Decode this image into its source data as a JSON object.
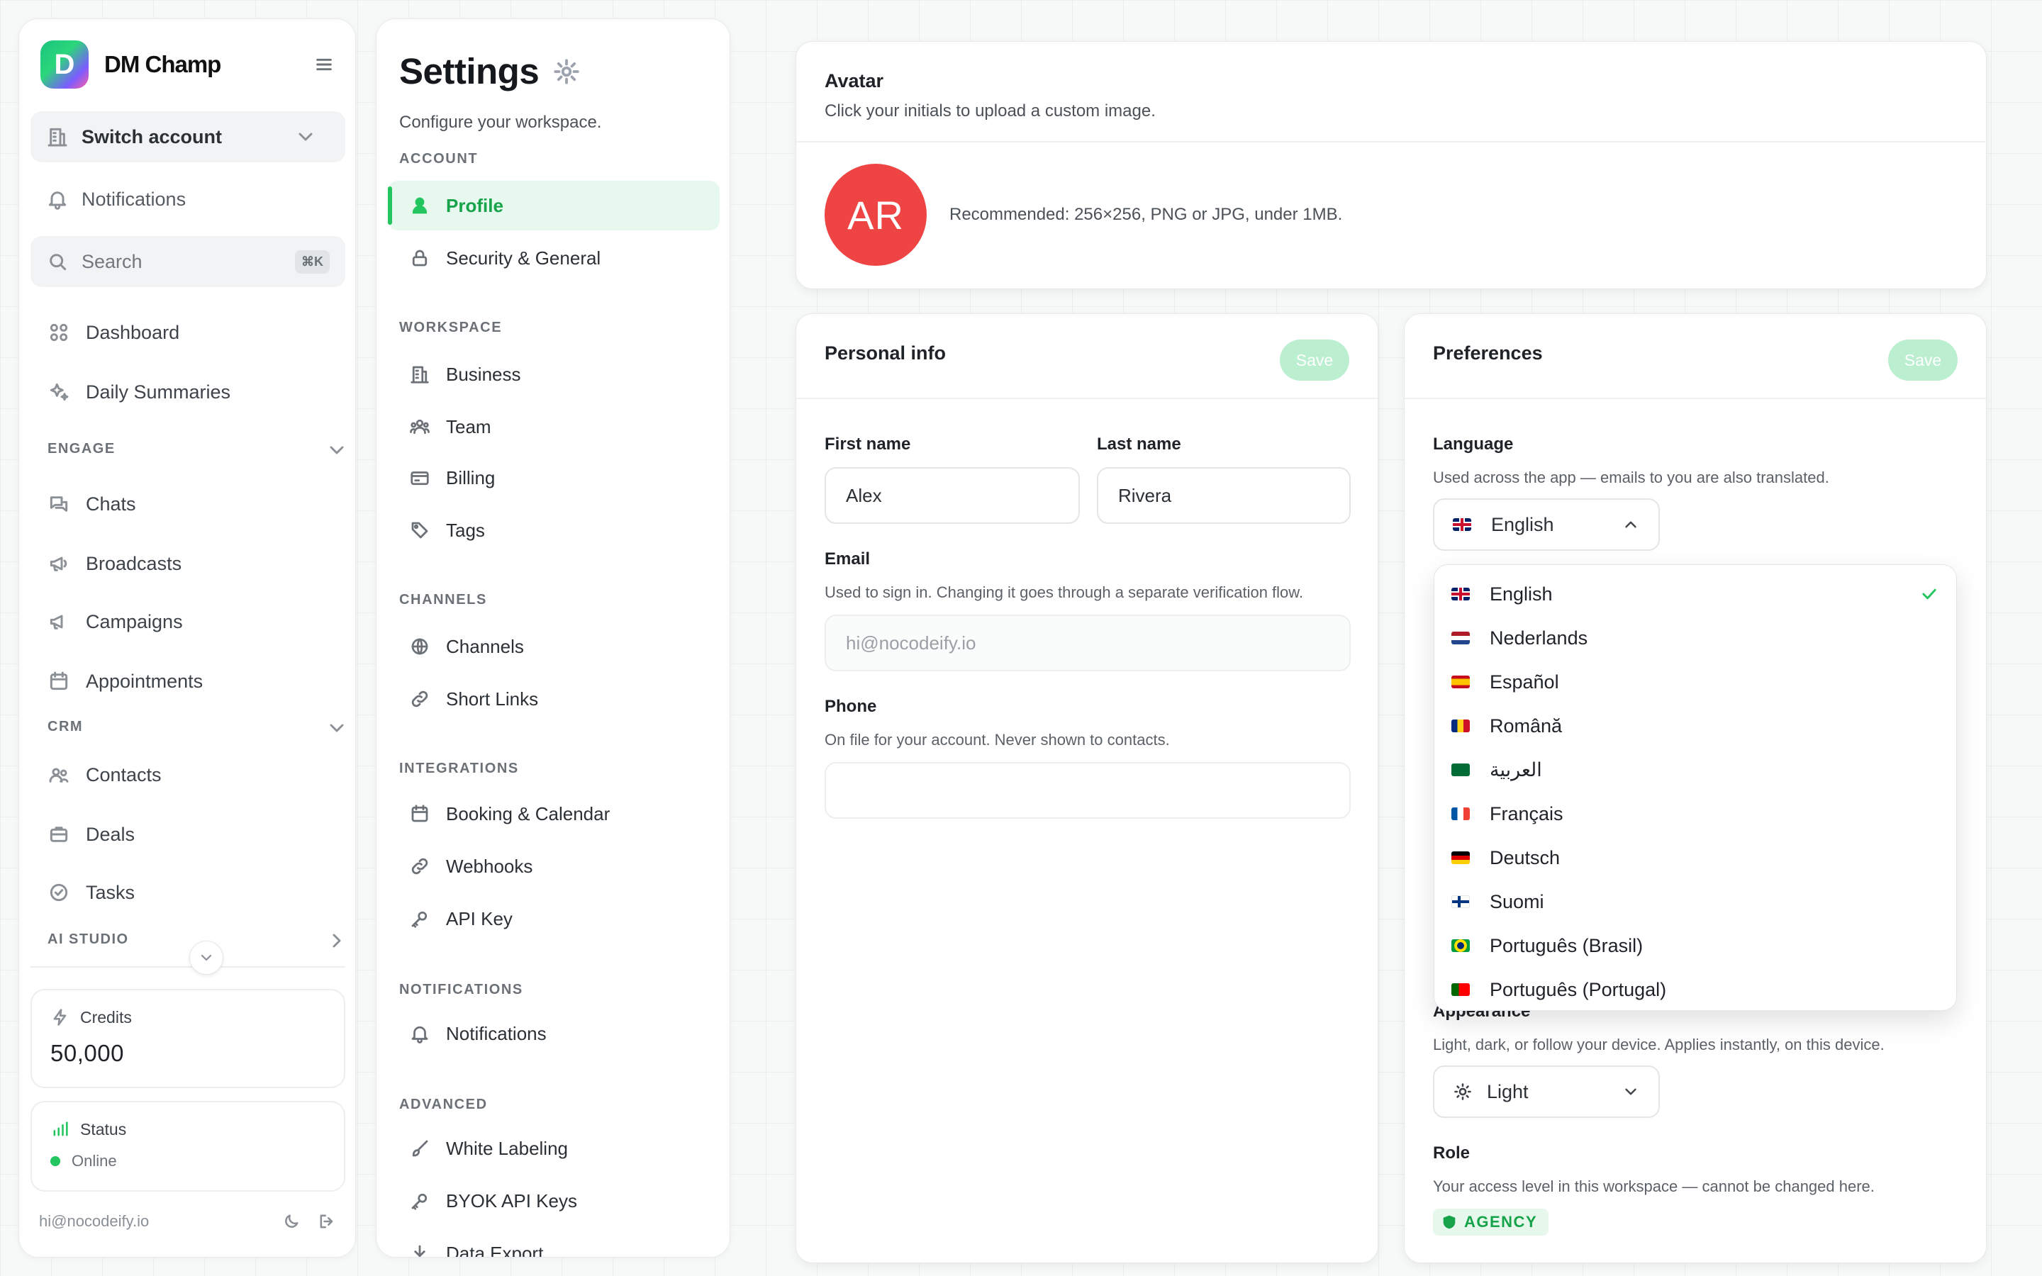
{
  "brand": {
    "logo_letter": "D",
    "name": "DM Champ"
  },
  "sidebar": {
    "switch_account": "Switch account",
    "notifications": "Notifications",
    "search_label": "Search",
    "search_shortcut": "⌘K",
    "dashboard": "Dashboard",
    "daily_summaries": "Daily Summaries",
    "engage_header": "ENGAGE",
    "chats": "Chats",
    "broadcasts": "Broadcasts",
    "campaigns": "Campaigns",
    "appointments": "Appointments",
    "crm_header": "CRM",
    "contacts": "Contacts",
    "deals": "Deals",
    "tasks": "Tasks",
    "ai_studio_header": "AI STUDIO",
    "credits_label": "Credits",
    "credits_value": "50,000",
    "status_label": "Status",
    "status_value": "Online",
    "user_email": "hi@nocodeify.io"
  },
  "settings": {
    "title": "Settings",
    "subtitle": "Configure your workspace.",
    "groups": {
      "account": "ACCOUNT",
      "workspace": "WORKSPACE",
      "channels": "CHANNELS",
      "integrations": "INTEGRATIONS",
      "notifications": "NOTIFICATIONS",
      "advanced": "ADVANCED"
    },
    "items": {
      "profile": "Profile",
      "security": "Security & General",
      "business": "Business",
      "team": "Team",
      "billing": "Billing",
      "tags": "Tags",
      "channels": "Channels",
      "short_links": "Short Links",
      "booking": "Booking & Calendar",
      "webhooks": "Webhooks",
      "api_key": "API Key",
      "notifications": "Notifications",
      "white_labeling": "White Labeling",
      "byok": "BYOK API Keys",
      "data_export": "Data Export"
    }
  },
  "avatar": {
    "title": "Avatar",
    "subtitle": "Click your initials to upload a custom image.",
    "initials": "AR",
    "recommendation": "Recommended: 256×256, PNG or JPG, under 1MB."
  },
  "personal": {
    "title": "Personal info",
    "save": "Save",
    "first_name_label": "First name",
    "first_name": "Alex",
    "last_name_label": "Last name",
    "last_name": "Rivera",
    "email_label": "Email",
    "email_help": "Used to sign in. Changing it goes through a separate verification flow.",
    "email": "hi@nocodeify.io",
    "phone_label": "Phone",
    "phone_help": "On file for your account. Never shown to contacts.",
    "phone": ""
  },
  "preferences": {
    "title": "Preferences",
    "save": "Save",
    "language_label": "Language",
    "language_help": "Used across the app — emails to you are also translated.",
    "language_selected": "English",
    "language_options": [
      "English",
      "Nederlands",
      "Español",
      "Română",
      "العربية",
      "Français",
      "Deutsch",
      "Suomi",
      "Português (Brasil)",
      "Português (Portugal)"
    ],
    "appearance_label": "Appearance",
    "appearance_help": "Light, dark, or follow your device. Applies instantly, on this device.",
    "appearance_selected": "Light",
    "role_label": "Role",
    "role_help": "Your access level in this workspace — cannot be changed here.",
    "role_badge": "AGENCY"
  },
  "colors": {
    "accent": "#22c55e",
    "avatar": "#ef4444",
    "save_disabled": "#bbefd0"
  }
}
